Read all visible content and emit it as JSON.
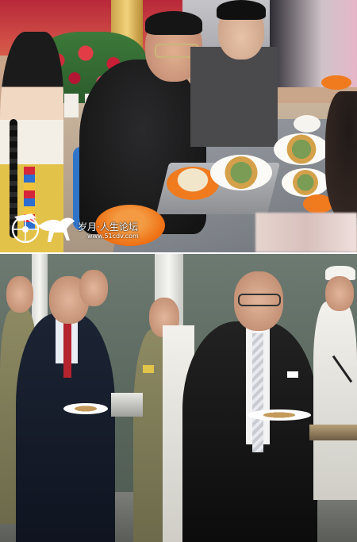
{
  "watermark": {
    "logo": "horse-carriage-logo",
    "site_name": "岁月·人生论坛",
    "url": "www.51cdv.com"
  },
  "panels": [
    {
      "id": "top-photo"
    },
    {
      "id": "bottom-photo"
    }
  ],
  "colors": {
    "background": "#ffffff",
    "orange_bowl": "#f07a1e",
    "blue_chair": "#2f74c9",
    "red_tie": "#b4232e"
  }
}
